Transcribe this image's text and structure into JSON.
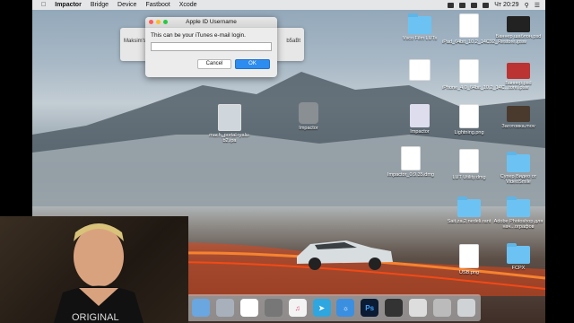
{
  "menubar": {
    "apple_icon": "apple-icon",
    "items": [
      "Impactor",
      "Bridge",
      "Device",
      "Fastboot",
      "Xcode"
    ],
    "clock": "Чт 20:29"
  },
  "dialog": {
    "title": "Apple ID Username",
    "message": "This can be your iTunes e-mail login.",
    "input_value": "",
    "cancel_label": "Cancel",
    "ok_label": "OK"
  },
  "background_window": {
    "left_text": "Maksim's",
    "right_text": "b5aBt"
  },
  "desktop_icons": [
    {
      "label": "mach_portal+yalu-b2.ipa",
      "kind": "ipa"
    },
    {
      "label": "Impactor",
      "kind": "app"
    },
    {
      "label": "Vsco Film LUTs",
      "kind": "folder"
    },
    {
      "label": "iPad_64bit_10.2_14C92_Restore.ipsw",
      "kind": "ipsw"
    },
    {
      "label": "Баннер шаблон.psd",
      "kind": "psd"
    },
    {
      "label": "iPhone_4.0_64bit_10.2_14C...tore.ipsw",
      "kind": "ipsw"
    },
    {
      "label": "Баннер.psd",
      "kind": "psd"
    },
    {
      "label": "Impactor",
      "kind": "disk"
    },
    {
      "label": "Lightning.png",
      "kind": "png"
    },
    {
      "label": "Заготовка.mov",
      "kind": "mov"
    },
    {
      "label": "Impactor_0.9.35.dmg",
      "kind": "dmg"
    },
    {
      "label": "LUT Utility.dmg",
      "kind": "dmg"
    },
    {
      "label": "Супер Видео от VideoSmile",
      "kind": "folder"
    },
    {
      "label": "Sait.za.2.nedeli.rant",
      "kind": "folder"
    },
    {
      "label": "Adobe Photoshop для нач...ографов",
      "kind": "folder"
    },
    {
      "label": "USB.png",
      "kind": "png"
    },
    {
      "label": "FCPX",
      "kind": "folder"
    }
  ],
  "dock": {
    "items": [
      "finder",
      "launchpad",
      "calendar",
      "font-book",
      "itunes",
      "telegram",
      "safari-icon",
      "photoshop",
      "final-cut",
      "preview",
      "image-capture",
      "trash"
    ],
    "photoshop_label": "Ps"
  },
  "webcam": {
    "shirt_text": "ORIGINAL"
  },
  "colors": {
    "ok_blue": "#2d8cf0",
    "folder_blue": "#6cc3f3"
  }
}
